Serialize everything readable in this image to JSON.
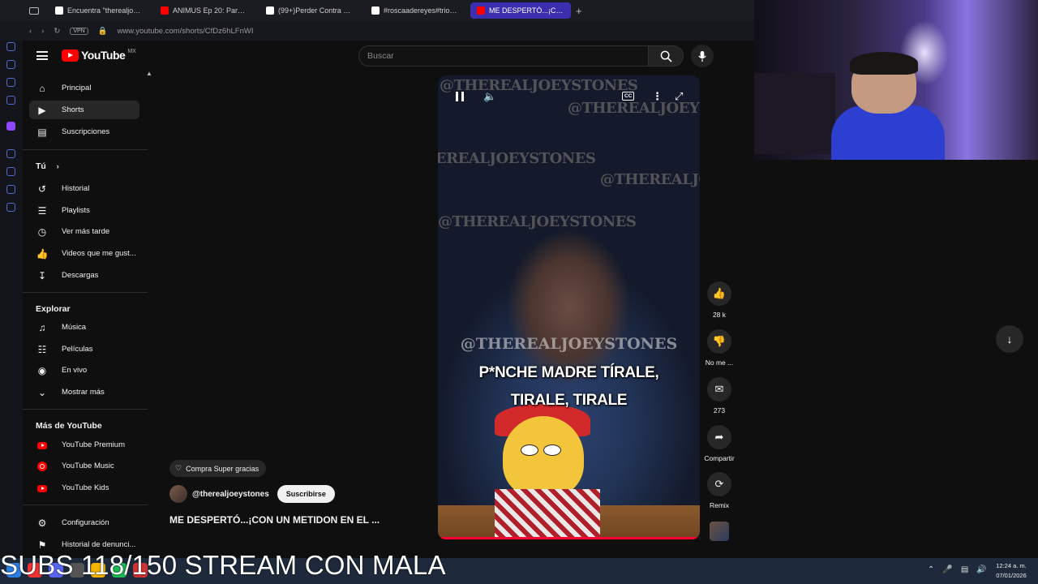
{
  "browser": {
    "tabs": [
      {
        "label": "Encuentra \"therealjoeystor",
        "favicon_color": "#ffffff"
      },
      {
        "label": "ANIMUS Ep 20: Para enter",
        "favicon_color": "#ff0000"
      },
      {
        "label": "(99+)Perder Contra El Jak",
        "favicon_color": "#ffffff"
      },
      {
        "label": "#roscaadereyes#triodeb",
        "favicon_color": "#ffffff"
      },
      {
        "label": "ME DESPERTÓ...¡CON",
        "favicon_color": "#ff0000",
        "active": true
      }
    ],
    "new_tab": "+",
    "vpn_label": "VPN",
    "url": "www.youtube.com/shorts/CfDz6hLFnWI"
  },
  "header": {
    "logo_text": "YouTube",
    "region": "MX",
    "search_placeholder": "Buscar"
  },
  "sidebar": {
    "main": [
      {
        "label": "Principal",
        "icon": "home-icon"
      },
      {
        "label": "Shorts",
        "icon": "shorts-icon",
        "active": true
      },
      {
        "label": "Suscripciones",
        "icon": "subscriptions-icon"
      }
    ],
    "you_title": "Tú",
    "you": [
      {
        "label": "Historial",
        "icon": "history-icon"
      },
      {
        "label": "Playlists",
        "icon": "playlist-icon"
      },
      {
        "label": "Ver más tarde",
        "icon": "clock-icon"
      },
      {
        "label": "Videos que me gust...",
        "icon": "thumbs-up-icon"
      },
      {
        "label": "Descargas",
        "icon": "download-icon"
      }
    ],
    "explore_title": "Explorar",
    "explore": [
      {
        "label": "Música",
        "icon": "music-icon"
      },
      {
        "label": "Películas",
        "icon": "film-icon"
      },
      {
        "label": "En vivo",
        "icon": "live-icon"
      },
      {
        "label": "Mostrar más",
        "icon": "chevron-down-icon"
      }
    ],
    "more_title": "Más de YouTube",
    "more": [
      {
        "label": "YouTube Premium",
        "icon": "youtube-premium-icon"
      },
      {
        "label": "YouTube Music",
        "icon": "youtube-music-icon"
      },
      {
        "label": "YouTube Kids",
        "icon": "youtube-kids-icon"
      }
    ],
    "settings": [
      {
        "label": "Configuración",
        "icon": "gear-icon"
      },
      {
        "label": "Historial de denunci...",
        "icon": "flag-icon"
      }
    ]
  },
  "video": {
    "watermark": "@THEREALJOEYSTONES",
    "caption_line1": "P*NCHE MADRE TÍRALE,",
    "caption_line2": "TIRALE, TIRALE",
    "cc_label": "CC",
    "progress_fraction": 1.0
  },
  "actions": {
    "likes": "28 k",
    "dislike_label": "No me ...",
    "comments": "273",
    "share_label": "Compartir",
    "remix_label": "Remix"
  },
  "info": {
    "super_thanks": "Compra Super gracias",
    "channel": "@therealjoeystones",
    "subscribe": "Suscribirse",
    "title": "ME DESPERTÓ...¡CON UN METIDON EN EL ..."
  },
  "overlay": {
    "text": "SUBS 118/150  STREAM CON MALA"
  },
  "taskbar": {
    "time": "12:24 a. m.",
    "date": "07/01/2026"
  },
  "colors": {
    "accent_red": "#ff0000",
    "active_tab": "#3b2fb0",
    "background": "#0f0f0f"
  }
}
